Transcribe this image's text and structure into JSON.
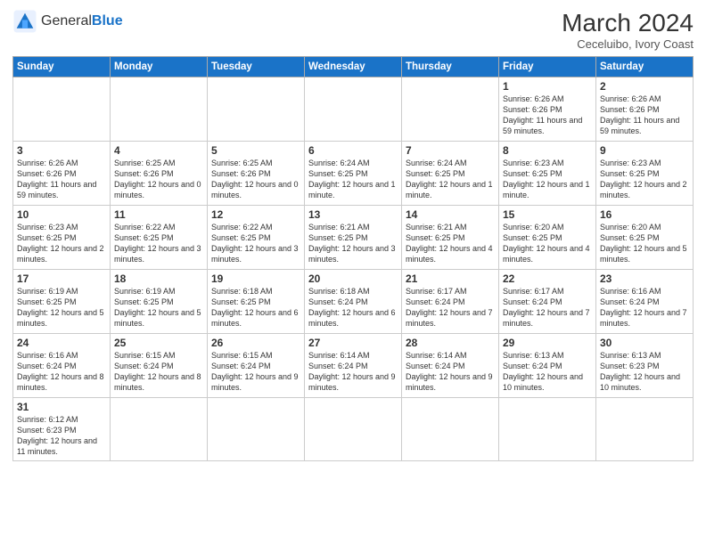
{
  "header": {
    "logo_general": "General",
    "logo_blue": "Blue",
    "title": "March 2024",
    "subtitle": "Ceceluibo, Ivory Coast"
  },
  "days_of_week": [
    "Sunday",
    "Monday",
    "Tuesday",
    "Wednesday",
    "Thursday",
    "Friday",
    "Saturday"
  ],
  "weeks": [
    [
      {
        "day": "",
        "info": "",
        "empty": true
      },
      {
        "day": "",
        "info": "",
        "empty": true
      },
      {
        "day": "",
        "info": "",
        "empty": true
      },
      {
        "day": "",
        "info": "",
        "empty": true
      },
      {
        "day": "",
        "info": "",
        "empty": true
      },
      {
        "day": "1",
        "info": "Sunrise: 6:26 AM\nSunset: 6:26 PM\nDaylight: 11 hours\nand 59 minutes."
      },
      {
        "day": "2",
        "info": "Sunrise: 6:26 AM\nSunset: 6:26 PM\nDaylight: 11 hours\nand 59 minutes."
      }
    ],
    [
      {
        "day": "3",
        "info": "Sunrise: 6:26 AM\nSunset: 6:26 PM\nDaylight: 11 hours\nand 59 minutes."
      },
      {
        "day": "4",
        "info": "Sunrise: 6:25 AM\nSunset: 6:26 PM\nDaylight: 12 hours\nand 0 minutes."
      },
      {
        "day": "5",
        "info": "Sunrise: 6:25 AM\nSunset: 6:26 PM\nDaylight: 12 hours\nand 0 minutes."
      },
      {
        "day": "6",
        "info": "Sunrise: 6:24 AM\nSunset: 6:25 PM\nDaylight: 12 hours\nand 1 minute."
      },
      {
        "day": "7",
        "info": "Sunrise: 6:24 AM\nSunset: 6:25 PM\nDaylight: 12 hours\nand 1 minute."
      },
      {
        "day": "8",
        "info": "Sunrise: 6:23 AM\nSunset: 6:25 PM\nDaylight: 12 hours\nand 1 minute."
      },
      {
        "day": "9",
        "info": "Sunrise: 6:23 AM\nSunset: 6:25 PM\nDaylight: 12 hours\nand 2 minutes."
      }
    ],
    [
      {
        "day": "10",
        "info": "Sunrise: 6:23 AM\nSunset: 6:25 PM\nDaylight: 12 hours\nand 2 minutes."
      },
      {
        "day": "11",
        "info": "Sunrise: 6:22 AM\nSunset: 6:25 PM\nDaylight: 12 hours\nand 3 minutes."
      },
      {
        "day": "12",
        "info": "Sunrise: 6:22 AM\nSunset: 6:25 PM\nDaylight: 12 hours\nand 3 minutes."
      },
      {
        "day": "13",
        "info": "Sunrise: 6:21 AM\nSunset: 6:25 PM\nDaylight: 12 hours\nand 3 minutes."
      },
      {
        "day": "14",
        "info": "Sunrise: 6:21 AM\nSunset: 6:25 PM\nDaylight: 12 hours\nand 4 minutes."
      },
      {
        "day": "15",
        "info": "Sunrise: 6:20 AM\nSunset: 6:25 PM\nDaylight: 12 hours\nand 4 minutes."
      },
      {
        "day": "16",
        "info": "Sunrise: 6:20 AM\nSunset: 6:25 PM\nDaylight: 12 hours\nand 5 minutes."
      }
    ],
    [
      {
        "day": "17",
        "info": "Sunrise: 6:19 AM\nSunset: 6:25 PM\nDaylight: 12 hours\nand 5 minutes."
      },
      {
        "day": "18",
        "info": "Sunrise: 6:19 AM\nSunset: 6:25 PM\nDaylight: 12 hours\nand 5 minutes."
      },
      {
        "day": "19",
        "info": "Sunrise: 6:18 AM\nSunset: 6:25 PM\nDaylight: 12 hours\nand 6 minutes."
      },
      {
        "day": "20",
        "info": "Sunrise: 6:18 AM\nSunset: 6:24 PM\nDaylight: 12 hours\nand 6 minutes."
      },
      {
        "day": "21",
        "info": "Sunrise: 6:17 AM\nSunset: 6:24 PM\nDaylight: 12 hours\nand 7 minutes."
      },
      {
        "day": "22",
        "info": "Sunrise: 6:17 AM\nSunset: 6:24 PM\nDaylight: 12 hours\nand 7 minutes."
      },
      {
        "day": "23",
        "info": "Sunrise: 6:16 AM\nSunset: 6:24 PM\nDaylight: 12 hours\nand 7 minutes."
      }
    ],
    [
      {
        "day": "24",
        "info": "Sunrise: 6:16 AM\nSunset: 6:24 PM\nDaylight: 12 hours\nand 8 minutes."
      },
      {
        "day": "25",
        "info": "Sunrise: 6:15 AM\nSunset: 6:24 PM\nDaylight: 12 hours\nand 8 minutes."
      },
      {
        "day": "26",
        "info": "Sunrise: 6:15 AM\nSunset: 6:24 PM\nDaylight: 12 hours\nand 9 minutes."
      },
      {
        "day": "27",
        "info": "Sunrise: 6:14 AM\nSunset: 6:24 PM\nDaylight: 12 hours\nand 9 minutes."
      },
      {
        "day": "28",
        "info": "Sunrise: 6:14 AM\nSunset: 6:24 PM\nDaylight: 12 hours\nand 9 minutes."
      },
      {
        "day": "29",
        "info": "Sunrise: 6:13 AM\nSunset: 6:24 PM\nDaylight: 12 hours\nand 10 minutes."
      },
      {
        "day": "30",
        "info": "Sunrise: 6:13 AM\nSunset: 6:23 PM\nDaylight: 12 hours\nand 10 minutes."
      }
    ],
    [
      {
        "day": "31",
        "info": "Sunrise: 6:12 AM\nSunset: 6:23 PM\nDaylight: 12 hours\nand 11 minutes."
      },
      {
        "day": "",
        "info": "",
        "empty": true
      },
      {
        "day": "",
        "info": "",
        "empty": true
      },
      {
        "day": "",
        "info": "",
        "empty": true
      },
      {
        "day": "",
        "info": "",
        "empty": true
      },
      {
        "day": "",
        "info": "",
        "empty": true
      },
      {
        "day": "",
        "info": "",
        "empty": true
      }
    ]
  ]
}
